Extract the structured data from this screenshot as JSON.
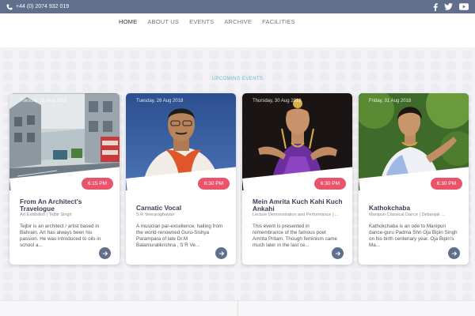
{
  "topbar": {
    "phone": "+44 (0) 2074 932 019",
    "social_icons": [
      "facebook-icon",
      "twitter-icon",
      "youtube-icon"
    ]
  },
  "nav": {
    "items": [
      "HOME",
      "ABOUT US",
      "EVENTS",
      "ARCHIVE",
      "FACILITIES"
    ],
    "active": "HOME"
  },
  "section": {
    "title": "UPCOMING EVENTS"
  },
  "colors": {
    "accent": "#e9546b",
    "topbar": "#5f6f8c",
    "section_title": "#6fb9c4"
  },
  "events": [
    {
      "date": "Tuesday, 21 Aug 2018",
      "time": "6:15 PM",
      "title": "From An Architect's Travelogue",
      "category": "Art Exhibition",
      "person": "Tejbir Singh",
      "description": "Tejbir is an architect / artist based in Bahrain. Art has always been his passion. He was introduced to oils in school a..."
    },
    {
      "date": "Tuesday, 28 Aug 2018",
      "time": "6:30 PM",
      "title": "Carnatic Vocal",
      "category": "S R Veeraraghavan",
      "person": "",
      "description": "A musician par-excellence, hailing from the world-renowned Guru-Sishya Parampara of late Dr.M Balamuralikrishna , S R Ve..."
    },
    {
      "date": "Thursday, 30 Aug 2018",
      "time": "6:30 PM",
      "title": "Mein Amrita Kuch Kahi Kuch Ankahi",
      "category": "Lecture Demonstration and Performance",
      "person": "...",
      "description": "This event is presented in remembrance of the famous poet Amrita Pritam. Though feminism came much later in the last ce..."
    },
    {
      "date": "Friday, 31 Aug 2018",
      "time": "6:30 PM",
      "title": "Kathokchaba",
      "category": "Manipuri Classical Dance",
      "person": "Debanjali ...",
      "description": "Kathokchaba is an ode to Manipuri dance-guru Padma Shri Oja Bipin Singh on his birth centenary year. Oja Bipin's Ma..."
    }
  ]
}
